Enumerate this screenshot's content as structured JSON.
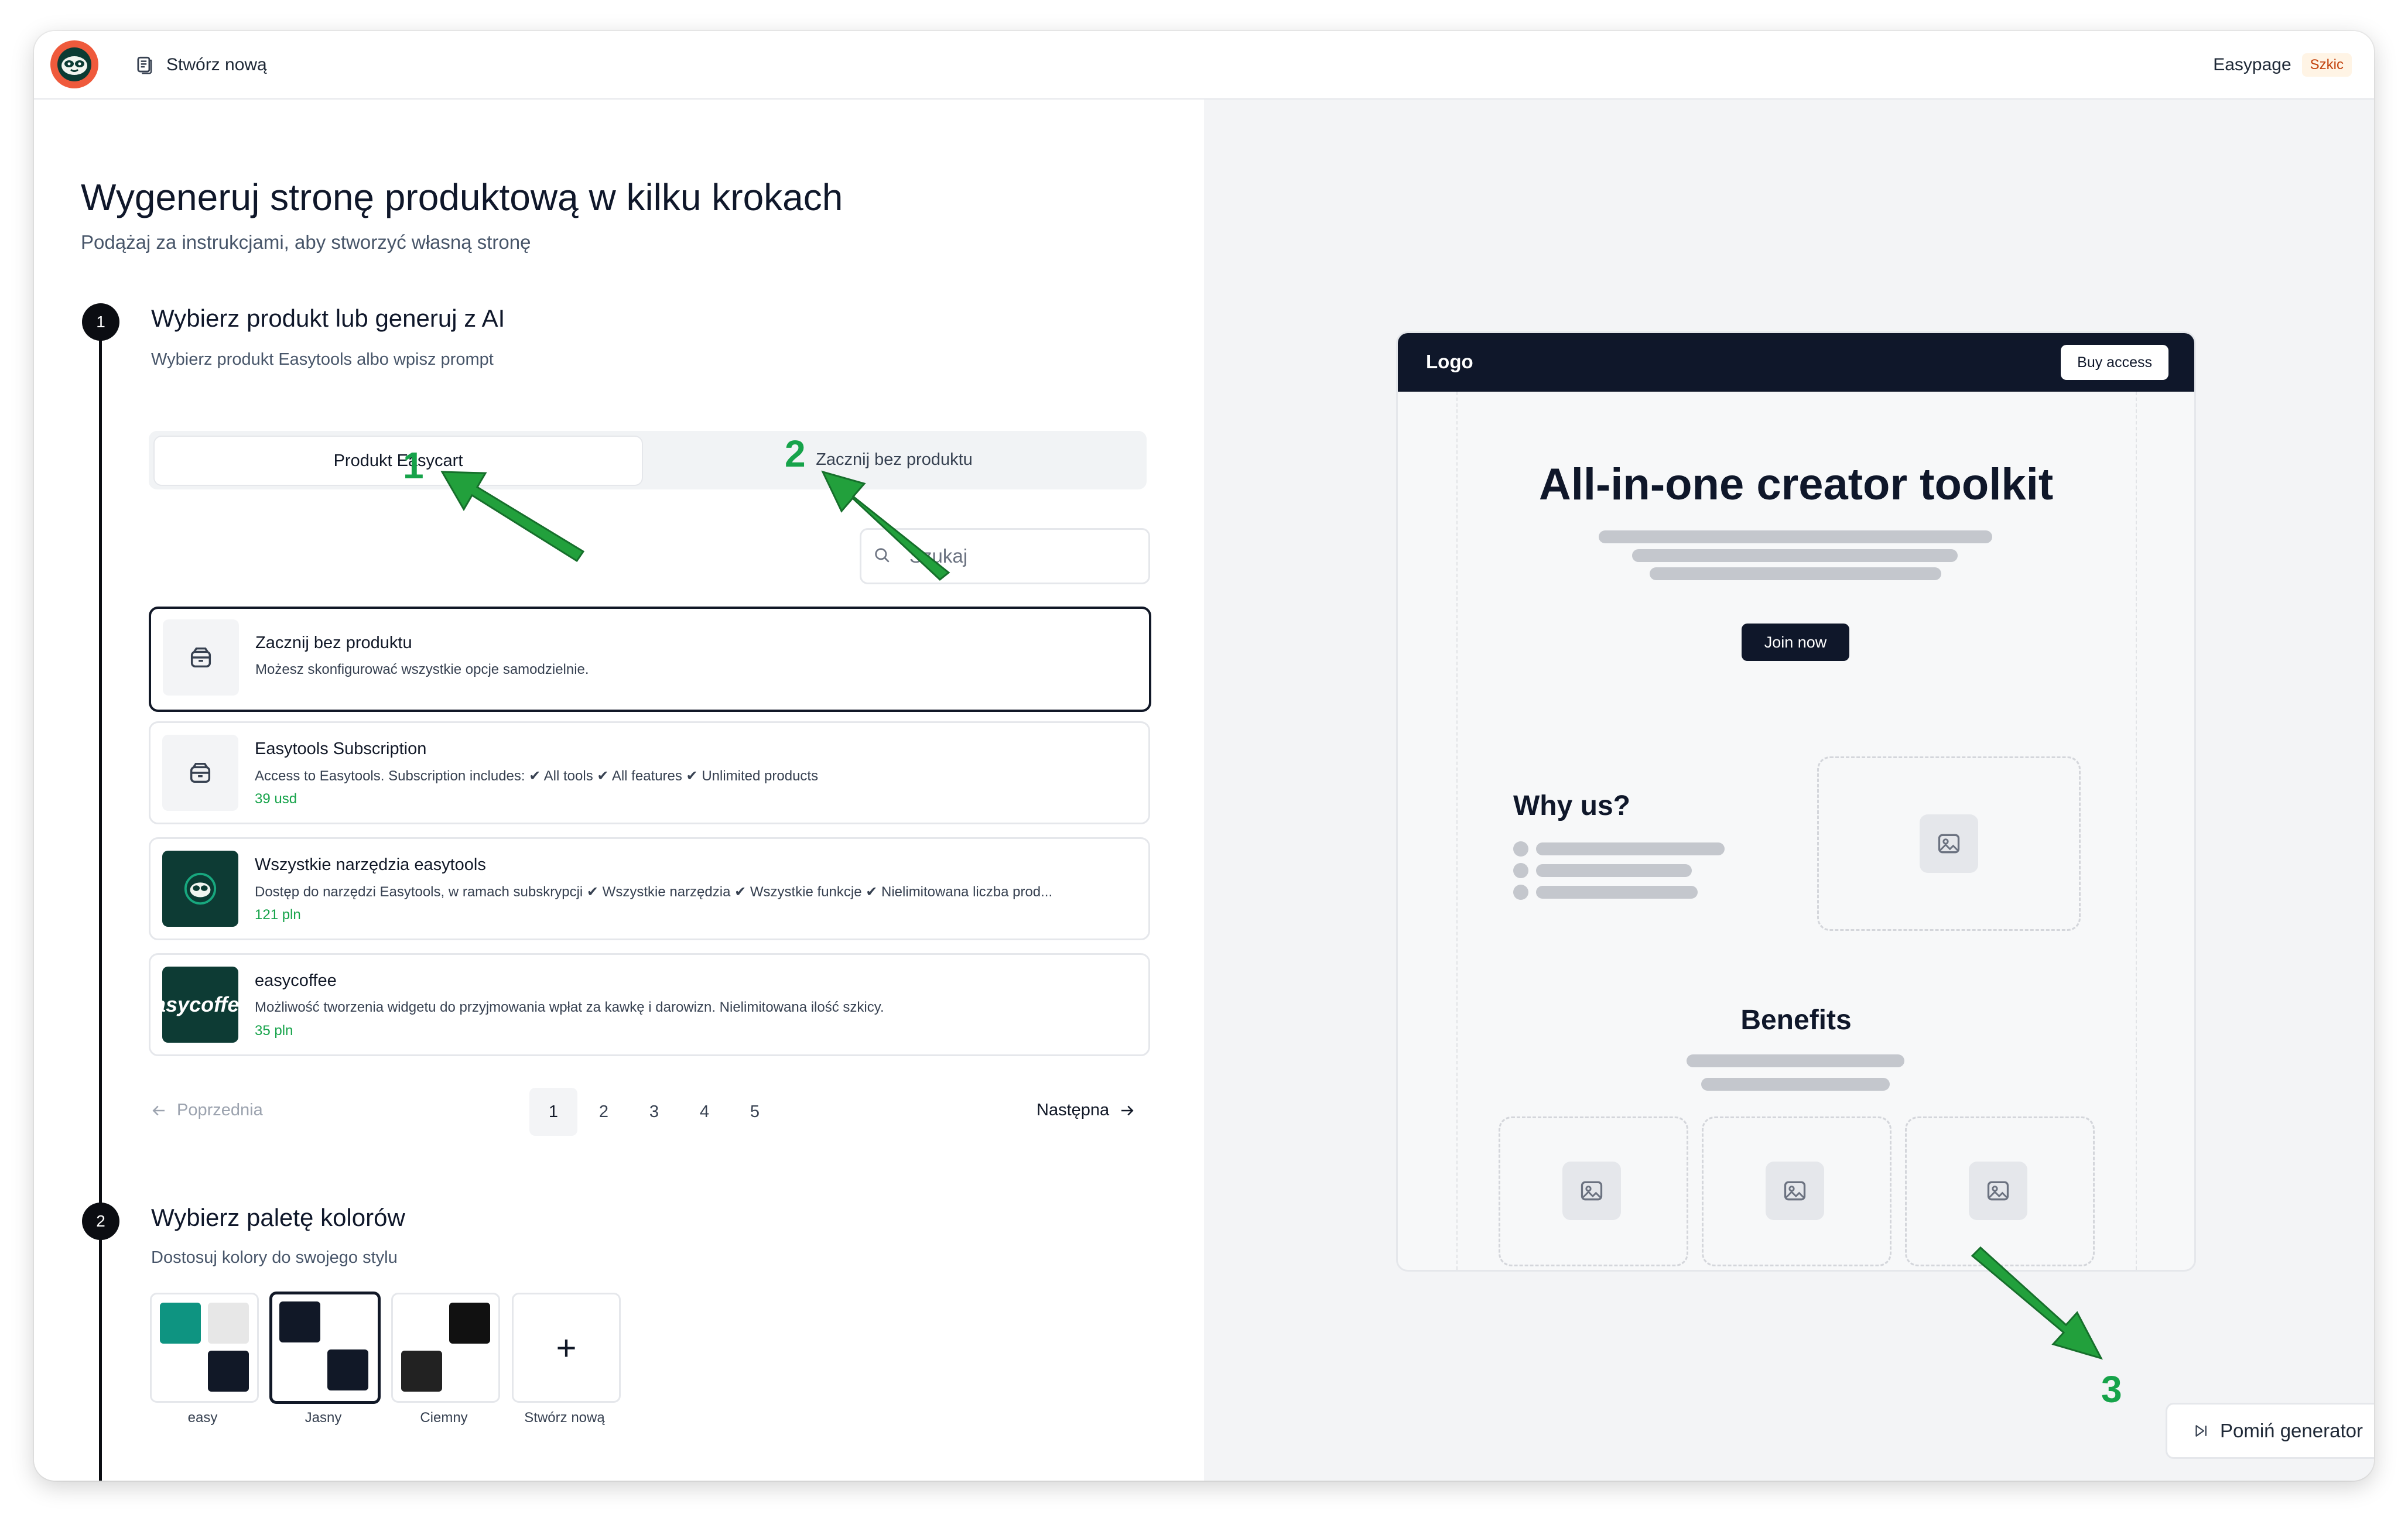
{
  "topbar": {
    "create_new_label": "Stwórz nową",
    "site_name": "Easypage",
    "status_badge": "Szkic"
  },
  "header": {
    "title": "Wygeneruj stronę produktową w kilku krokach",
    "subtitle": "Podążaj za instrukcjami, aby stworzyć własną stronę"
  },
  "step1": {
    "number": "1",
    "title": "Wybierz produkt lub generuj z AI",
    "subtitle": "Wybierz produkt Easytools albo wpisz prompt",
    "tabs": [
      "Produkt Easycart",
      "Zacznij bez produktu"
    ],
    "search_placeholder": "Szukaj",
    "products": [
      {
        "name": "Zacznij bez produktu",
        "desc": "Możesz skonfigurować wszystkie opcje samodzielnie.",
        "price": ""
      },
      {
        "name": "Easytools Subscription",
        "desc": "Access to Easytools. Subscription includes: ✔ All tools ✔ All features ✔ Unlimited products",
        "price": "39 usd"
      },
      {
        "name": "Wszystkie narzędzia easytools",
        "desc": "Dostęp do narzędzi Easytools, w ramach subskrypcji ✔ Wszystkie narzędzia ✔ Wszystkie funkcje ✔ Nielimitowana liczba prod...",
        "price": "121 pln"
      },
      {
        "name": "easycoffee",
        "desc": "Możliwość tworzenia widgetu do przyjmowania wpłat za kawkę i darowizn. Nielimitowana ilość szkicy.",
        "price": "35 pln",
        "thumb_text": "asycoffe"
      }
    ],
    "pagination": {
      "prev": "Poprzednia",
      "next": "Następna",
      "pages": [
        "1",
        "2",
        "3",
        "4",
        "5"
      ],
      "current": "1"
    }
  },
  "step2": {
    "number": "2",
    "title": "Wybierz paletę kolorów",
    "subtitle": "Dostosuj kolory do swojego stylu",
    "palettes": [
      {
        "label": "easy",
        "colors": [
          "#0e9481",
          "#e7e7e7",
          "#ffffff",
          "#111827"
        ]
      },
      {
        "label": "Jasny",
        "colors": [
          "#111827",
          "#ffffff",
          "#ffffff",
          "#111827"
        ]
      },
      {
        "label": "Ciemny",
        "colors": [
          "#ffffff",
          "#111111",
          "#222222",
          "#ffffff"
        ]
      }
    ],
    "create_label": "Stwórz nową",
    "create_symbol": "+"
  },
  "preview": {
    "logo": "Logo",
    "buy_button": "Buy access",
    "hero_title": "All-in-one creator toolkit",
    "cta": "Join now",
    "why_title": "Why us?",
    "benefits_title": "Benefits"
  },
  "skip_button": "Pomiń generator",
  "annotations": [
    "1",
    "2",
    "3"
  ],
  "colors": {
    "accent_green": "#16a34a",
    "dark": "#0f172a",
    "badge_text": "#c2410c"
  }
}
